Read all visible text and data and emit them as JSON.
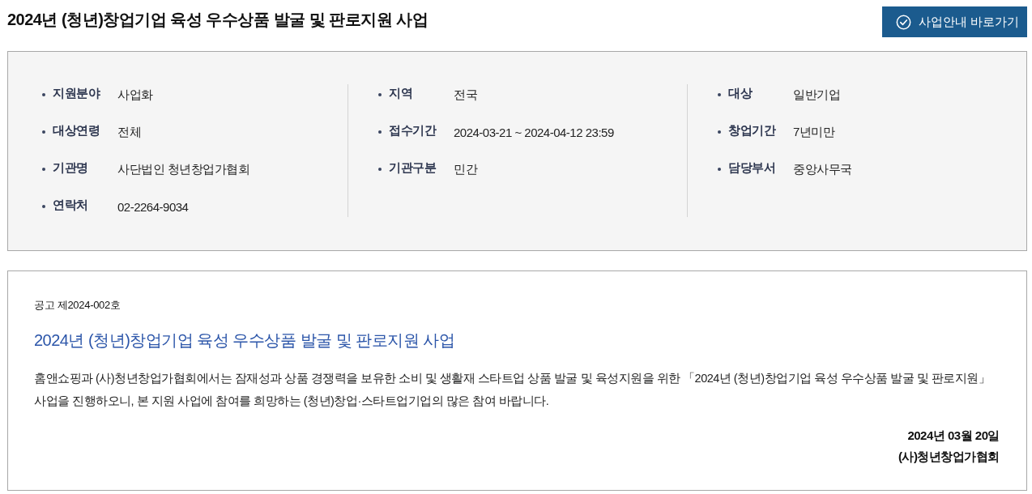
{
  "page": {
    "title": "2024년 (청년)창업기업 육성 우수상품 발굴 및 판로지원 사업"
  },
  "guide_button": {
    "label": "사업안내 바로가기"
  },
  "info_panel": {
    "columns": [
      {
        "items": [
          {
            "label": "지원분야",
            "value": "사업화"
          },
          {
            "label": "대상연령",
            "value": "전체"
          },
          {
            "label": "기관명",
            "value": "사단법인 청년창업가협회"
          },
          {
            "label": "연락처",
            "value": "02-2264-9034"
          }
        ]
      },
      {
        "items": [
          {
            "label": "지역",
            "value": "전국"
          },
          {
            "label": "접수기간",
            "value": "2024-03-21 ~ 2024-04-12 23:59"
          },
          {
            "label": "기관구분",
            "value": "민간"
          }
        ]
      },
      {
        "items": [
          {
            "label": "대상",
            "value": "일반기업"
          },
          {
            "label": "창업기간",
            "value": "7년미만"
          },
          {
            "label": "담당부서",
            "value": "중앙사무국"
          }
        ]
      }
    ]
  },
  "notice": {
    "number": "공고 제2024-002호",
    "title": "2024년 (청년)창업기업 육성 우수상품 발굴 및 판로지원 사업",
    "body": "홈앤쇼핑과 (사)청년창업가협회에서는 잠재성과 상품 경쟁력을 보유한 소비 및 생활재 스타트업 상품 발굴 및 육성지원을 위한 「2024년 (청년)창업기업 육성 우수상품 발굴 및 판로지원」 사업을 진행하오니, 본 지원 사업에 참여를 희망하는 (청년)창업·스타트업기업의 많은 참여 바랍니다.",
    "date": "2024년 03월 20일",
    "issuer": "(사)청년창업가협회"
  }
}
